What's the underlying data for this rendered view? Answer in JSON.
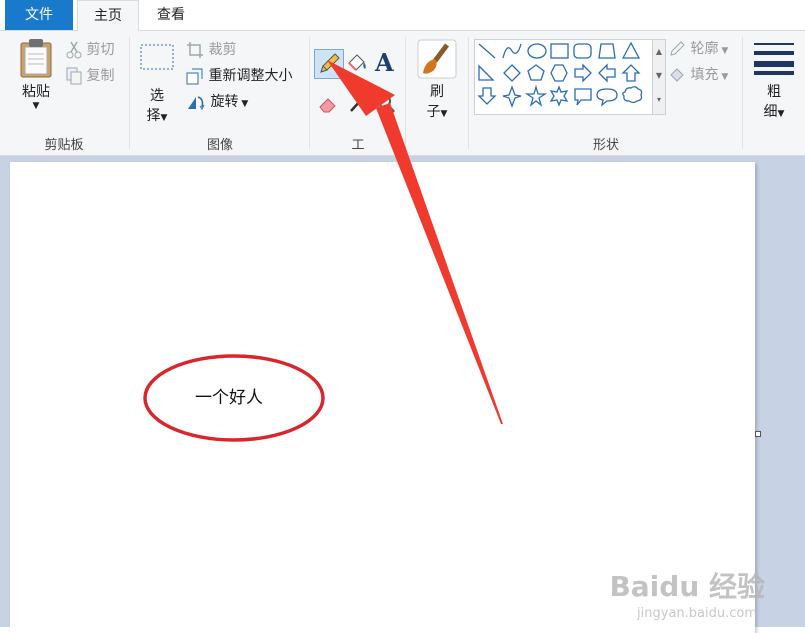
{
  "tabs": {
    "file": "文件",
    "home": "主页",
    "view": "查看"
  },
  "clipboard": {
    "paste": "粘贴",
    "cut": "剪切",
    "copy": "复制",
    "label": "剪贴板"
  },
  "image": {
    "select_top": "选",
    "select_bottom": "择",
    "crop": "裁剪",
    "resize": "重新调整大小",
    "rotate": "旋转",
    "label": "图像"
  },
  "tools": {
    "label": "工具",
    "label_visible": "工"
  },
  "brushes": {
    "label_top": "刷",
    "label_bottom": "子"
  },
  "shapes": {
    "label": "形状",
    "outline": "轮廓",
    "fill": "填充"
  },
  "size": {
    "label_top": "粗",
    "label_bottom": "细"
  },
  "canvas": {
    "text": "一个好人",
    "ellipse_color": "#d9262c",
    "arrow_color": "#f03a2e"
  },
  "watermark": {
    "logo": "Baidu 经验",
    "url": "jingyan.baidu.com"
  },
  "colors": {
    "accent": "#1979ca",
    "ribbon_bg": "#f5f6f7",
    "workspace_bg": "#c7d2e4",
    "icon_blue": "#2a6db3"
  }
}
